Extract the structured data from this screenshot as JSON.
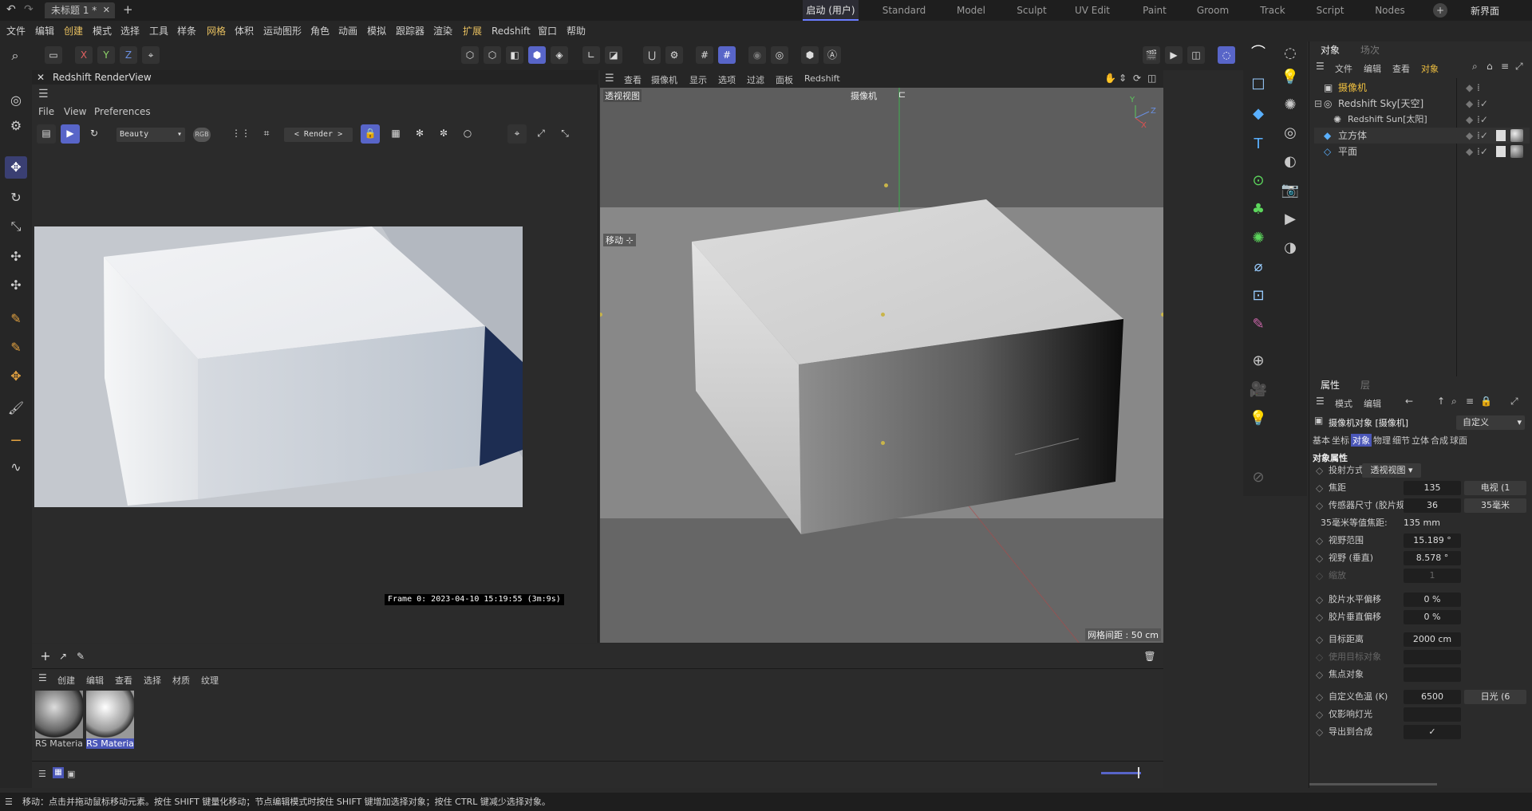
{
  "titlebar": {
    "doc_tab": "未标题 1 *",
    "add_tab": "+",
    "workspaces": [
      "启动 (用户)",
      "Standard",
      "Model",
      "Sculpt",
      "UV Edit",
      "Paint",
      "Groom",
      "Track",
      "Script",
      "Nodes"
    ],
    "active_workspace": "启动 (用户)",
    "new_interface": "新界面"
  },
  "menubar": {
    "items": [
      "文件",
      "编辑",
      "创建",
      "模式",
      "选择",
      "工具",
      "样条",
      "网格",
      "体积",
      "运动图形",
      "角色",
      "动画",
      "模拟",
      "跟踪器",
      "渲染",
      "扩展",
      "Redshift",
      "窗口",
      "帮助"
    ],
    "accent_items": [
      "创建",
      "网格",
      "扩展"
    ]
  },
  "axis_buttons": [
    "X",
    "Y",
    "Z"
  ],
  "renderview": {
    "title": "Redshift RenderView",
    "menu": [
      "File",
      "View",
      "Preferences"
    ],
    "aov": "Beauty",
    "channel": "RGB",
    "render_mode": "< Render >",
    "frame_info": "Frame  0:  2023-04-10  15:19:55  (3m:9s)"
  },
  "viewport": {
    "menu": [
      "查看",
      "摄像机",
      "显示",
      "选项",
      "过滤",
      "面板",
      "Redshift"
    ],
    "view_name": "透视视图",
    "camera_label": "摄像机",
    "move_label": "移动",
    "grid_spacing": "网格间距 : 50 cm",
    "axes": {
      "y": "Y",
      "z": "Z",
      "x": "X"
    }
  },
  "objects": {
    "tabs": [
      "对象",
      "场次"
    ],
    "menu": [
      "文件",
      "编辑",
      "查看",
      "对象"
    ],
    "active_menu": "对象",
    "items": [
      {
        "name": "摄像机",
        "icon": "camera-icon",
        "selected": true
      },
      {
        "name": "Redshift Sky[天空]",
        "icon": "sky-icon"
      },
      {
        "name": "Redshift Sun[太阳]",
        "icon": "sun-icon",
        "child": true
      },
      {
        "name": "立方体",
        "icon": "cube-icon"
      },
      {
        "name": "平面",
        "icon": "plane-icon"
      }
    ]
  },
  "attributes": {
    "tabs": [
      "属性",
      "层"
    ],
    "menu": [
      "模式",
      "编辑"
    ],
    "object_title": "摄像机对象 [摄像机]",
    "preset": "自定义",
    "subtabs": [
      "基本",
      "坐标",
      "对象",
      "物理",
      "细节",
      "立体",
      "合成",
      "球面"
    ],
    "active_subtab": "对象",
    "section": "对象属性",
    "projection": {
      "label": "投射方式",
      "value": "透视视图"
    },
    "rows": [
      {
        "label": "焦距",
        "value": "135",
        "extra": "电视 (1"
      },
      {
        "label": "传感器尺寸 (胶片规格)",
        "value": "36",
        "extra": "35毫米"
      },
      {
        "label": "35毫米等值焦距:",
        "value": "135 mm",
        "plain": true
      },
      {
        "label": "视野范围",
        "value": "15.189 °"
      },
      {
        "label": "视野 (垂直)",
        "value": "8.578 °"
      },
      {
        "label": "缩放",
        "value": "1",
        "disabled": true
      },
      {
        "label": "胶片水平偏移",
        "value": "0 %"
      },
      {
        "label": "胶片垂直偏移",
        "value": "0 %"
      },
      {
        "label": "目标距离",
        "value": "2000 cm"
      },
      {
        "label": "使用目标对象",
        "value": "",
        "disabled": true
      },
      {
        "label": "焦点对象",
        "value": ""
      },
      {
        "label": "自定义色温 (K)",
        "value": "6500",
        "extra": "日光 (6"
      },
      {
        "label": "仅影响灯光",
        "value": ""
      },
      {
        "label": "导出到合成",
        "value": "✓"
      }
    ]
  },
  "materials": {
    "menu": [
      "创建",
      "编辑",
      "查看",
      "选择",
      "材质",
      "纹理"
    ],
    "items": [
      {
        "name": "RS Materia",
        "selected": false
      },
      {
        "name": "RS Materia",
        "selected": true
      }
    ]
  },
  "status": "移动：点击并拖动鼠标移动元素。按住 SHIFT 键量化移动；节点编辑模式时按住 SHIFT 键增加选择对象；按住 CTRL 键减少选择对象。",
  "colors": {
    "accent": "#5865c8",
    "selected_text": "#f0c040",
    "menu_accent": "#e8c060"
  }
}
